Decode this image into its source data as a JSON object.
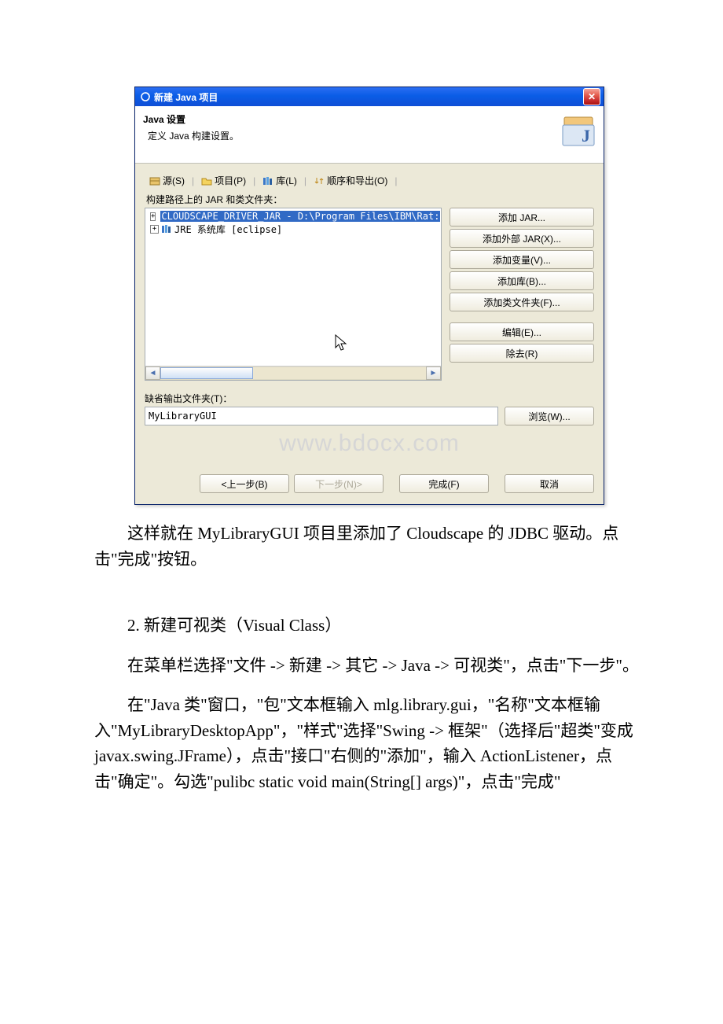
{
  "dialog": {
    "title": "新建 Java 项目",
    "banner_title": "Java 设置",
    "banner_sub": "定义 Java 构建设置。",
    "tabs": {
      "source": "源(S)",
      "project": "项目(P)",
      "library": "库(L)",
      "order": "顺序和导出(O)"
    },
    "tree_label": "构建路径上的 JAR 和类文件夹：",
    "tree": {
      "cloudscape": "CLOUDSCAPE_DRIVER_JAR - D:\\Program Files\\IBM\\Rat:",
      "jre": "JRE 系统库 [eclipse]"
    },
    "buttons": {
      "add_jar": "添加 JAR...",
      "add_ext_jar": "添加外部 JAR(X)...",
      "add_var": "添加变量(V)...",
      "add_lib": "添加库(B)...",
      "add_class_folder": "添加类文件夹(F)...",
      "edit": "编辑(E)...",
      "remove": "除去(R)"
    },
    "out_label": "缺省输出文件夹(T)：",
    "out_value": "MyLibraryGUI",
    "browse": "浏览(W)...",
    "watermark": "www.bdocx.com",
    "wizard": {
      "back": "<上一步(B)",
      "next": "下一步(N)>",
      "finish": "完成(F)",
      "cancel": "取消"
    }
  },
  "text": {
    "p1": "这样就在 MyLibraryGUI 项目里添加了 Cloudscape 的 JDBC 驱动。点击\"完成\"按钮。",
    "h2": "2. 新建可视类（Visual Class）",
    "p2": "在菜单栏选择\"文件 -> 新建 -> 其它 -> Java -> 可视类\"，点击\"下一步\"。",
    "p3": "在\"Java 类\"窗口，\"包\"文本框输入 mlg.library.gui，\"名称\"文本框输入\"MyLibraryDesktopApp\"，\"样式\"选择\"Swing -> 框架\"（选择后\"超类\"变成 javax.swing.JFrame），点击\"接口\"右侧的\"添加\"，输入 ActionListener，点击\"确定\"。勾选\"pulibc static void main(String[] args)\"，点击\"完成\""
  }
}
